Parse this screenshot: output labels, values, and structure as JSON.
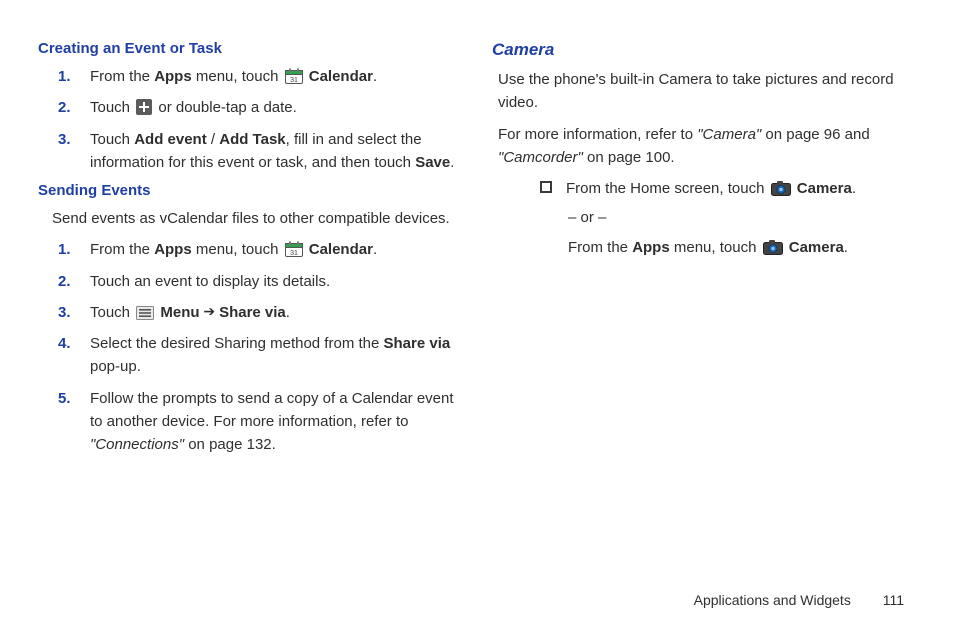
{
  "left": {
    "h1": "Creating an Event or Task",
    "steps1": [
      {
        "pre": "From the ",
        "b1": "Apps",
        "mid": " menu, touch ",
        "icon": "calendar",
        "b2": "Calendar",
        "post": "."
      },
      {
        "pre": "Touch ",
        "icon": "plus",
        "post2": " or double-tap a date."
      },
      {
        "pre": "Touch ",
        "b1": "Add event",
        "mid": " / ",
        "b2": "Add Task",
        "post": ", fill in and select the information for this event or task, and then touch ",
        "b3": "Save",
        "post2": "."
      }
    ],
    "h2": "Sending Events",
    "intro2": "Send events as vCalendar files to other compatible devices.",
    "steps2": [
      {
        "pre": "From the ",
        "b1": "Apps",
        "mid": " menu, touch ",
        "icon": "calendar",
        "b2": "Calendar",
        "post2": "."
      },
      {
        "plain": "Touch an event to display its details."
      },
      {
        "pre": "Touch ",
        "icon": "menu",
        "b1": "Menu",
        "arrow": " ➔ ",
        "b2": "Share via",
        "post2": "."
      },
      {
        "pre": "Select the desired Sharing method from the ",
        "b1": "Share via",
        "post2": " pop-up."
      },
      {
        "pre": "Follow the prompts to send a copy of a Calendar event to another device. For more information, refer to ",
        "iq": "\"Connections\"",
        "post2": " on page 132."
      }
    ]
  },
  "right": {
    "h1": "Camera",
    "p1": "Use the phone's built-in Camera to take pictures and record video.",
    "p2a": "For more information, refer to ",
    "p2q1": "\"Camera\"",
    "p2b": " on page 96 and ",
    "p2q2": "\"Camcorder\"",
    "p2c": " on page 100.",
    "b1pre": "From the Home screen, touch ",
    "b1bold": "Camera",
    "b1post": ".",
    "or": "– or –",
    "b2pre": "From the ",
    "b2b1": "Apps",
    "b2mid": " menu, touch ",
    "b2bold": "Camera",
    "b2post": "."
  },
  "footer": {
    "section": "Applications and Widgets",
    "page": "111"
  }
}
